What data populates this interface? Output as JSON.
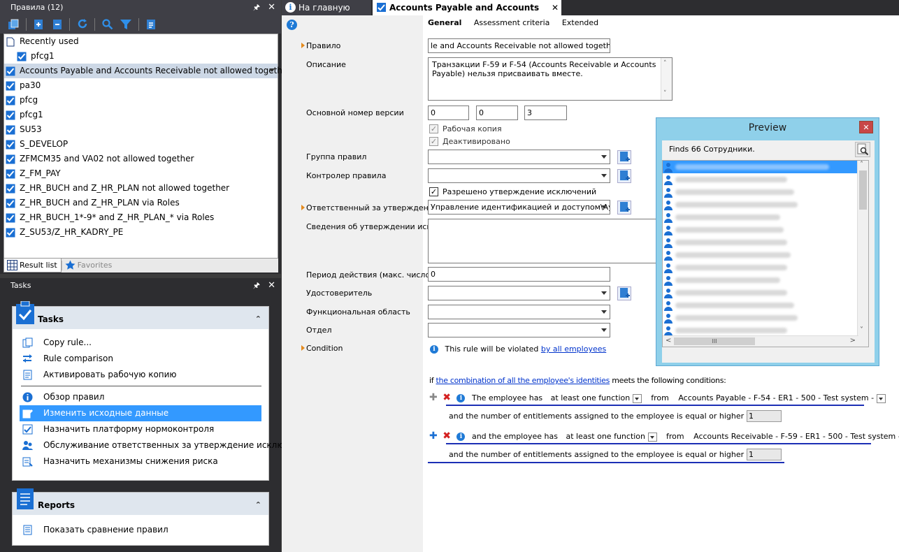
{
  "rules_panel": {
    "title": "Правила (12)",
    "pin": "⍙",
    "close": "✕",
    "tree": [
      {
        "label": "Recently used",
        "icon": "document-icon",
        "indent": 0,
        "selected": false
      },
      {
        "label": "pfcg1",
        "icon": "rule-icon",
        "indent": 1,
        "selected": false
      },
      {
        "label": "Accounts Payable and Accounts Receivable not allowed together",
        "icon": "rule-icon",
        "indent": 0,
        "selected": true
      },
      {
        "label": "pa30",
        "icon": "rule-icon",
        "indent": 0,
        "selected": false
      },
      {
        "label": "pfcg",
        "icon": "rule-icon",
        "indent": 0,
        "selected": false
      },
      {
        "label": "pfcg1",
        "icon": "rule-icon",
        "indent": 0,
        "selected": false
      },
      {
        "label": "SU53",
        "icon": "rule-icon",
        "indent": 0,
        "selected": false
      },
      {
        "label": "S_DEVELOP",
        "icon": "rule-icon",
        "indent": 0,
        "selected": false
      },
      {
        "label": "ZFMCM35 and VA02 not allowed together",
        "icon": "rule-icon",
        "indent": 0,
        "selected": false
      },
      {
        "label": "Z_FM_PAY",
        "icon": "rule-icon",
        "indent": 0,
        "selected": false
      },
      {
        "label": "Z_HR_BUCH and Z_HR_PLAN not allowed together",
        "icon": "rule-icon",
        "indent": 0,
        "selected": false
      },
      {
        "label": "Z_HR_BUCH and Z_HR_PLAN via Roles",
        "icon": "rule-icon",
        "indent": 0,
        "selected": false
      },
      {
        "label": "Z_HR_BUCH_1*-9* and Z_HR_PLAN_* via Roles",
        "icon": "rule-icon",
        "indent": 0,
        "selected": false
      },
      {
        "label": "Z_SU53/Z_HR_KADRY_PE",
        "icon": "rule-icon",
        "indent": 0,
        "selected": false
      }
    ],
    "bottom_tabs": [
      {
        "label": "Result list",
        "active": true
      },
      {
        "label": "Favorites",
        "active": false
      }
    ]
  },
  "tasks_panel": {
    "title": "Tasks",
    "tasks_header": "Tasks",
    "tasks_group1": [
      {
        "label": "Copy rule...",
        "icon": "copy-icon"
      },
      {
        "label": "Rule comparison",
        "icon": "compare-icon"
      },
      {
        "label": "Активировать рабочую копию",
        "icon": "activate-icon"
      }
    ],
    "tasks_group2": [
      {
        "label": "Обзор правил",
        "icon": "info-icon",
        "highlight": false
      },
      {
        "label": "Изменить исходные данные",
        "icon": "edit-icon",
        "highlight": true
      },
      {
        "label": "Назначить платформу нормоконтроля",
        "icon": "assign-icon",
        "highlight": false
      },
      {
        "label": "Обслуживание ответственных за утверждение исключений",
        "icon": "people-icon",
        "highlight": false
      },
      {
        "label": "Назначить механизмы снижения риска",
        "icon": "mitigation-icon",
        "highlight": false
      }
    ],
    "reports_header": "Reports",
    "reports": [
      {
        "label": "Показать сравнение правил",
        "icon": "report-icon"
      }
    ]
  },
  "doc_tabs": {
    "home": "На главную",
    "rule": "Accounts Payable and Accounts Rece...",
    "close": "✕"
  },
  "form": {
    "tabs": [
      "General",
      "Assessment criteria",
      "Extended"
    ],
    "labels": {
      "rule": "Правило",
      "description": "Описание",
      "version": "Основной номер версии",
      "group": "Группа правил",
      "controller": "Контролер правила",
      "approver": "Ответственный за утверждение...",
      "approval_info": "Сведения об утверждении искл...",
      "period": "Период действия (макс. число...",
      "certifier": "Удостоверитель",
      "functional_area": "Функциональная область",
      "department": "Отдел",
      "condition": "Condition"
    },
    "values": {
      "rule": "le and Accounts Receivable not allowed together",
      "description": "Транзакции F-59 и F-54 (Accounts Receivable и Accounts Payable) нельзя присваивать вместе.",
      "version": [
        "0",
        "0",
        "3"
      ],
      "group": "",
      "controller": "",
      "approver": "Управление идентификацией и доступом\\Ау",
      "approval_info": "",
      "period": "0",
      "certifier": "",
      "functional_area": "",
      "department": ""
    },
    "checkboxes": {
      "working_copy": {
        "label": "Рабочая копия",
        "checked": true,
        "disabled": true
      },
      "deactivated": {
        "label": "Деактивировано",
        "checked": true,
        "disabled": true
      },
      "exceptions_allowed": {
        "label": "Разрешено утверждение исключений",
        "checked": true,
        "disabled": false
      }
    },
    "condition": {
      "violated_prefix": "This rule will be violated ",
      "violated_link": "by all employees",
      "if_text": "if ",
      "combination_link": "the combination of all the employee's identities",
      "meets_text": " meets the following conditions:",
      "rows": [
        {
          "prefix": "The employee has",
          "quantifier": "at least one function",
          "from": "from",
          "source": "Accounts Payable - F-54 - ER1 - 500 - Test system -",
          "threshold_text": "and the number of entitlements assigned to the employee is equal or higher than",
          "threshold": "1"
        },
        {
          "prefix": "and the employee has",
          "quantifier": "at least one function",
          "from": "from",
          "source": "Accounts Receivable - F-59 - ER1 - 500 - Test system -",
          "threshold_text": "and the number of entitlements assigned to the employee is equal or higher than",
          "threshold": "1"
        }
      ]
    }
  },
  "preview": {
    "title": "Preview",
    "close": "✕",
    "finds": "Finds 66 Сотрудники.",
    "hscroll_thumb": "III",
    "rows": 17
  },
  "colors": {
    "accent": "#3399ff",
    "selection": "#cdd8e6",
    "link": "#0033cc",
    "dark_bg": "#2d2d30",
    "preview_frame": "#8fd0ea"
  }
}
